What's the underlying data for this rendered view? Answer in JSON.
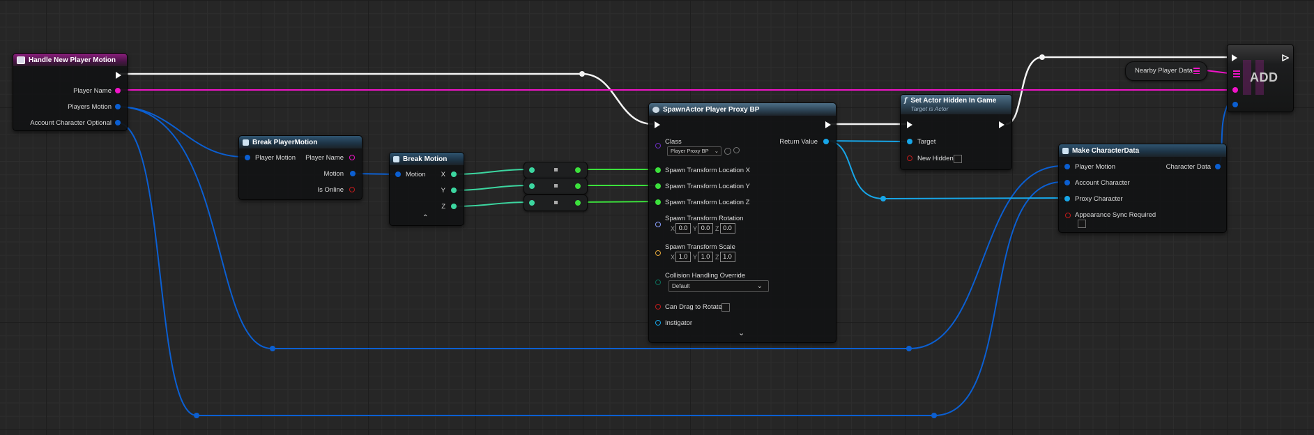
{
  "editor": "Blueprint Event Graph",
  "colors": {
    "exec": "#ffffff",
    "string": "#f014c8",
    "struct": "#0b5fd2",
    "object": "#17a6e8",
    "float": "#3ce13c",
    "bool": "#c21b1b",
    "class": "#6b2ec2",
    "rotator": "#8aa0ff",
    "vector": "#e0a53a",
    "enum": "#0b6e5a"
  },
  "nodes": {
    "event": {
      "title": "Handle New Player Motion",
      "outputs": [
        "Player Name",
        "Players Motion",
        "Account Character Optional"
      ]
    },
    "break_player_motion": {
      "title": "Break PlayerMotion",
      "input": "Player Motion",
      "outputs": [
        "Player Name",
        "Motion",
        "Is Online"
      ]
    },
    "break_motion": {
      "title": "Break Motion",
      "input": "Motion",
      "outputs": [
        "X",
        "Y",
        "Z"
      ],
      "expand_icon": "chevron-up-icon"
    },
    "spawn_actor": {
      "title": "SpawnActor Player Proxy BP",
      "class_label": "Class",
      "class_value": "Player Proxy BP",
      "return_label": "Return Value",
      "loc_x": "Spawn Transform Location X",
      "loc_y": "Spawn Transform Location Y",
      "loc_z": "Spawn Transform Location Z",
      "rotation_label": "Spawn Transform Rotation",
      "rotation": {
        "x": "0.0",
        "y": "0.0",
        "z": "0.0"
      },
      "scale_label": "Spawn Transform Scale",
      "scale": {
        "x": "1.0",
        "y": "1.0",
        "z": "1.0"
      },
      "axis": {
        "x": "X",
        "y": "Y",
        "z": "Z"
      },
      "collision_label": "Collision Handling Override",
      "collision_value": "Default",
      "can_drag_label": "Can Drag to Rotate",
      "instigator_label": "Instigator",
      "expand_icon": "chevron-down-icon"
    },
    "set_hidden": {
      "title": "Set Actor Hidden In Game",
      "subtitle": "Target is Actor",
      "target_label": "Target",
      "new_hidden_label": "New Hidden"
    },
    "make_character_data": {
      "title": "Make CharacterData",
      "inputs": [
        "Player Motion",
        "Account Character",
        "Proxy Character",
        "Appearance Sync Required"
      ],
      "output": "Character Data"
    },
    "nearby_player_data": {
      "label": "Nearby Player Data"
    },
    "add": {
      "label": "ADD"
    }
  }
}
